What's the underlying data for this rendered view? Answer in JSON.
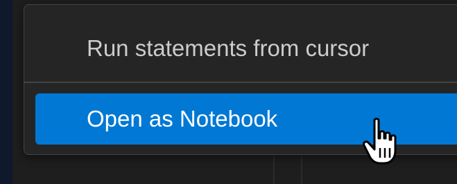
{
  "context_menu": {
    "items": [
      {
        "label": "Run statements from cursor"
      },
      {
        "label": "Open as Notebook",
        "highlighted": true
      }
    ]
  },
  "colors": {
    "menu_background": "#252526",
    "highlight": "#0078d4",
    "text": "#cccccc",
    "highlight_text": "#ffffff"
  },
  "pointer": {
    "icon": "hand-pointer-icon"
  }
}
